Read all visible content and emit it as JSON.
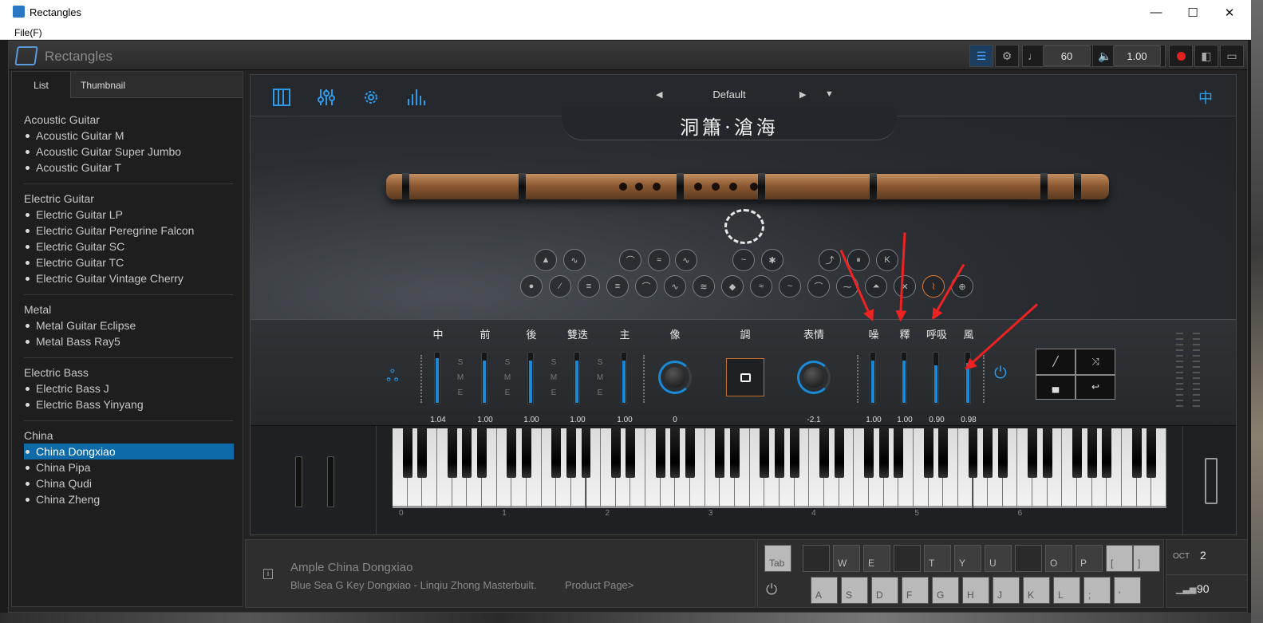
{
  "window": {
    "title": "Rectangles",
    "minimize": "—",
    "maximize": "☐",
    "close": "✕"
  },
  "menu": {
    "file": "File(F)"
  },
  "app": {
    "name": "Rectangles",
    "tempo": "60",
    "volume": "1.00",
    "accent": "#1a8ad6",
    "record_color": "#e02020"
  },
  "sidebar": {
    "tabs": [
      "List",
      "Thumbnail"
    ],
    "groups": [
      {
        "title": "Acoustic Guitar",
        "items": [
          "Acoustic Guitar M",
          "Acoustic Guitar Super Jumbo",
          "Acoustic Guitar T"
        ]
      },
      {
        "title": "Electric Guitar",
        "items": [
          "Electric Guitar LP",
          "Electric Guitar Peregrine Falcon",
          "Electric Guitar SC",
          "Electric Guitar TC",
          "Electric Guitar Vintage Cherry"
        ]
      },
      {
        "title": "Metal",
        "items": [
          "Metal Guitar Eclipse",
          "Metal Bass Ray5"
        ]
      },
      {
        "title": "Electric Bass",
        "items": [
          "Electric Bass J",
          "Electric Bass Yinyang"
        ]
      },
      {
        "title": "China",
        "items": [
          "China Dongxiao",
          "China Pipa",
          "China Qudi",
          "China Zheng"
        ]
      }
    ],
    "selected": "China Dongxiao"
  },
  "plugin": {
    "preset": "Default",
    "instrument_title": "洞簫·滄海",
    "lang_button": "中",
    "mixer": {
      "channels": [
        {
          "label": "中",
          "value": "1.04",
          "level": 0.9
        },
        {
          "label": "前",
          "value": "1.00",
          "level": 0.85
        },
        {
          "label": "後",
          "value": "1.00",
          "level": 0.85
        },
        {
          "label": "雙迭",
          "value": "1.00",
          "level": 0.85
        },
        {
          "label": "主",
          "value": "1.00",
          "level": 0.85
        }
      ],
      "sme": [
        "S",
        "M",
        "E"
      ],
      "knob1": {
        "label": "像",
        "value": "0"
      },
      "pad": {
        "label": "調"
      },
      "knob2": {
        "label": "表情",
        "value": "-2.1"
      },
      "noise": [
        {
          "label": "噪",
          "value": "1.00",
          "level": 0.85
        },
        {
          "label": "釋",
          "value": "1.00",
          "level": 0.85
        },
        {
          "label": "呼吸",
          "value": "0.90",
          "level": 0.75
        },
        {
          "label": "風",
          "value": "0.98",
          "level": 0.8
        }
      ]
    },
    "octave_labels": [
      "0",
      "1",
      "2",
      "3",
      "4",
      "5",
      "6"
    ]
  },
  "info": {
    "name": "Ample China Dongxiao",
    "description": "Blue Sea G Key Dongxiao - Linqiu Zhong Masterbuilt.",
    "link": "Product Page>"
  },
  "qwerty": {
    "top_row": [
      "Tab",
      "",
      "W",
      "E",
      "",
      "T",
      "Y",
      "U",
      "",
      "O",
      "P",
      "[",
      "]"
    ],
    "bottom_row": [
      "A",
      "S",
      "D",
      "F",
      "G",
      "H",
      "J",
      "K",
      "L",
      ";",
      "'"
    ]
  },
  "oct_panel": {
    "oct_label": "OCT",
    "oct_value": "2",
    "velocity_value": "90"
  }
}
